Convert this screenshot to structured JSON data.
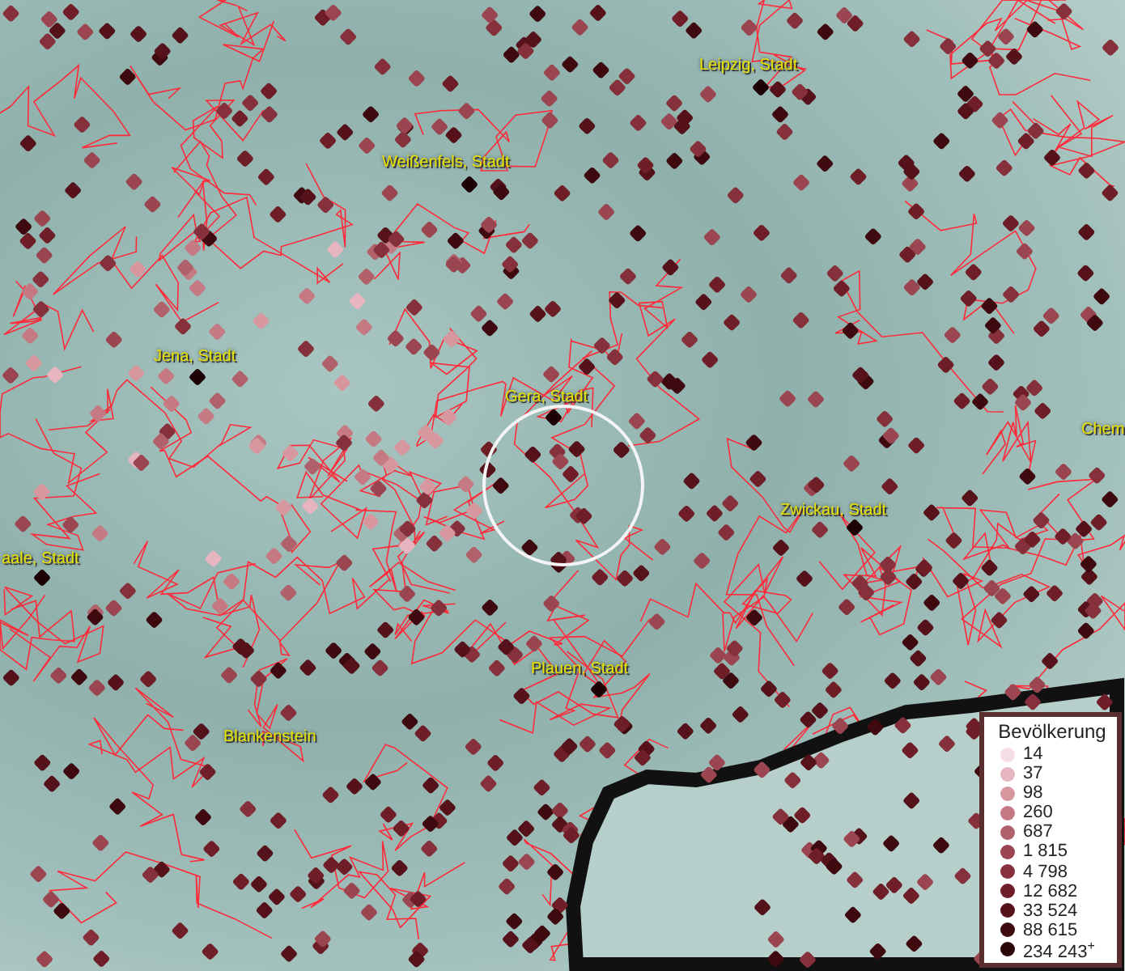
{
  "map": {
    "places": [
      {
        "label": "Leipzig, Stadt"
      },
      {
        "label": "Weißenfels, Stadt"
      },
      {
        "label": "Jena, Stadt"
      },
      {
        "label": "Gera, Stadt"
      },
      {
        "label": "Chem"
      },
      {
        "label": "Zwickau, Stadt"
      },
      {
        "label": "aale, Stadt"
      },
      {
        "label": "Plauen, Stadt"
      },
      {
        "label": "Blankenstein"
      }
    ]
  },
  "legend": {
    "title": "Bevölkerung",
    "classes": [
      {
        "label": "14",
        "color": "#f5dde6"
      },
      {
        "label": "37",
        "color": "#e6b5c0"
      },
      {
        "label": "98",
        "color": "#d6979f"
      },
      {
        "label": "260",
        "color": "#c57a83"
      },
      {
        "label": "687",
        "color": "#b0616a"
      },
      {
        "label": "1 815",
        "color": "#9a4550"
      },
      {
        "label": "4 798",
        "color": "#85303a"
      },
      {
        "label": "12 682",
        "color": "#6f1e28"
      },
      {
        "label": "33 524",
        "color": "#55121a"
      },
      {
        "label": "88 615",
        "color": "#3e0a10"
      },
      {
        "label": "234 243$^{+}$",
        "color": "#2a0508"
      }
    ]
  }
}
